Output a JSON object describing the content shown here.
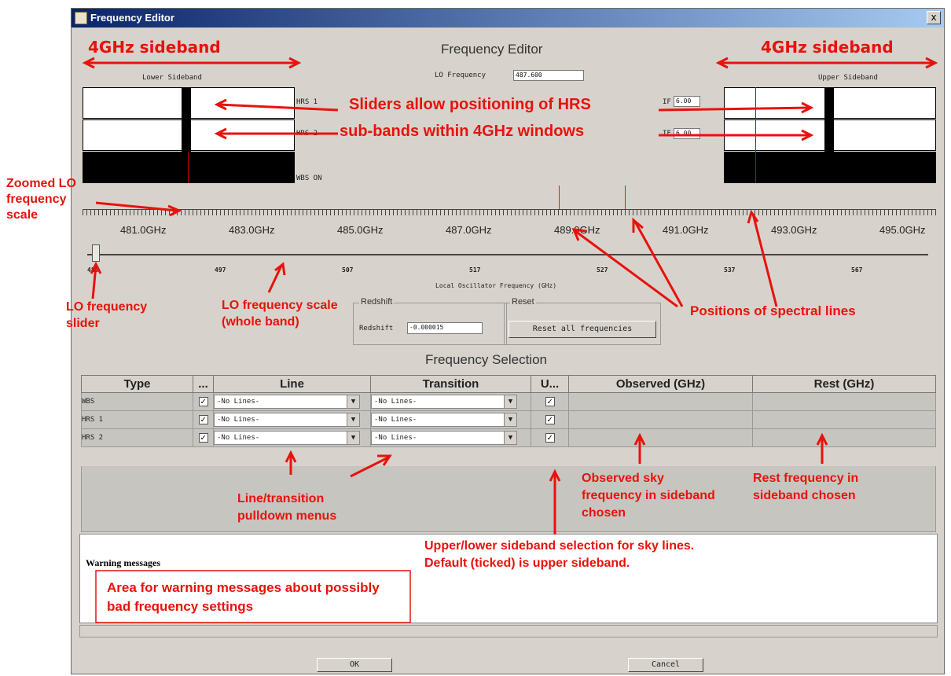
{
  "window": {
    "title": "Frequency Editor",
    "close_glyph": "x"
  },
  "header": {
    "title": "Frequency Editor",
    "lower_label": "Lower Sideband",
    "upper_label": "Upper Sideband",
    "lo_label": "LO Frequency",
    "lo_value": "487.600"
  },
  "hrs": [
    {
      "label": "HRS 1",
      "if_label": "IF",
      "if_value": "6.00"
    },
    {
      "label": "HRS 2",
      "if_label": "IF",
      "if_value": "6.00"
    }
  ],
  "wbs_status": "WBS ON",
  "zoom_scale": {
    "ticks": [
      "481.0GHz",
      "483.0GHz",
      "485.0GHz",
      "487.0GHz",
      "489.0GHz",
      "491.0GHz",
      "493.0GHz",
      "495.0GHz"
    ]
  },
  "lo_slider": {
    "labels": [
      "480",
      "497",
      "507",
      "517",
      "527",
      "537",
      "567"
    ],
    "caption": "Local Oscillator Frequency (GHz)",
    "position": 0.0
  },
  "redshift": {
    "group_label": "Redshift",
    "field_label": "Redshift",
    "value": "-0.000015"
  },
  "reset": {
    "group_label": "Reset",
    "button_label": "Reset all frequencies"
  },
  "selection": {
    "title": "Frequency Selection",
    "columns": [
      "Type",
      "...",
      "Line",
      "Transition",
      "U...",
      "Observed (GHz)",
      "Rest (GHz)"
    ],
    "rows": [
      {
        "type": "WBS",
        "line": "-No Lines-",
        "transition": "-No Lines-"
      },
      {
        "type": "HRS 1",
        "line": "-No Lines-",
        "transition": "-No Lines-"
      },
      {
        "type": "HRS 2",
        "line": "-No Lines-",
        "transition": "-No Lines-"
      }
    ],
    "check_glyph": "✓"
  },
  "warnings": {
    "title": "Warning messages"
  },
  "buttons": {
    "ok": "OK",
    "cancel": "Cancel"
  },
  "annotations": {
    "sideband_left": "4GHz sideband",
    "sideband_right": "4GHz sideband",
    "sliders_line1": "Sliders allow positioning of HRS",
    "sliders_line2": "sub-bands within 4GHz windows",
    "zoomed_lo": "Zoomed LO frequency scale",
    "lo_slider": "LO frequency slider",
    "lo_scale": "LO frequency scale (whole band)",
    "spectral": "Positions of spectral lines",
    "pulldown": "Line/transition pulldown menus",
    "observed": "Observed sky frequency in sideband chosen",
    "rest": "Rest frequency in sideband chosen",
    "sideband_sel": "Upper/lower sideband selection for sky lines. Default (ticked) is upper sideband.",
    "warning_area": "Area for warning messages about possibly bad frequency settings"
  },
  "colors": {
    "annotation": "#e8120c",
    "titlebar": "#0a246a",
    "panel": "#d7d3cc"
  }
}
